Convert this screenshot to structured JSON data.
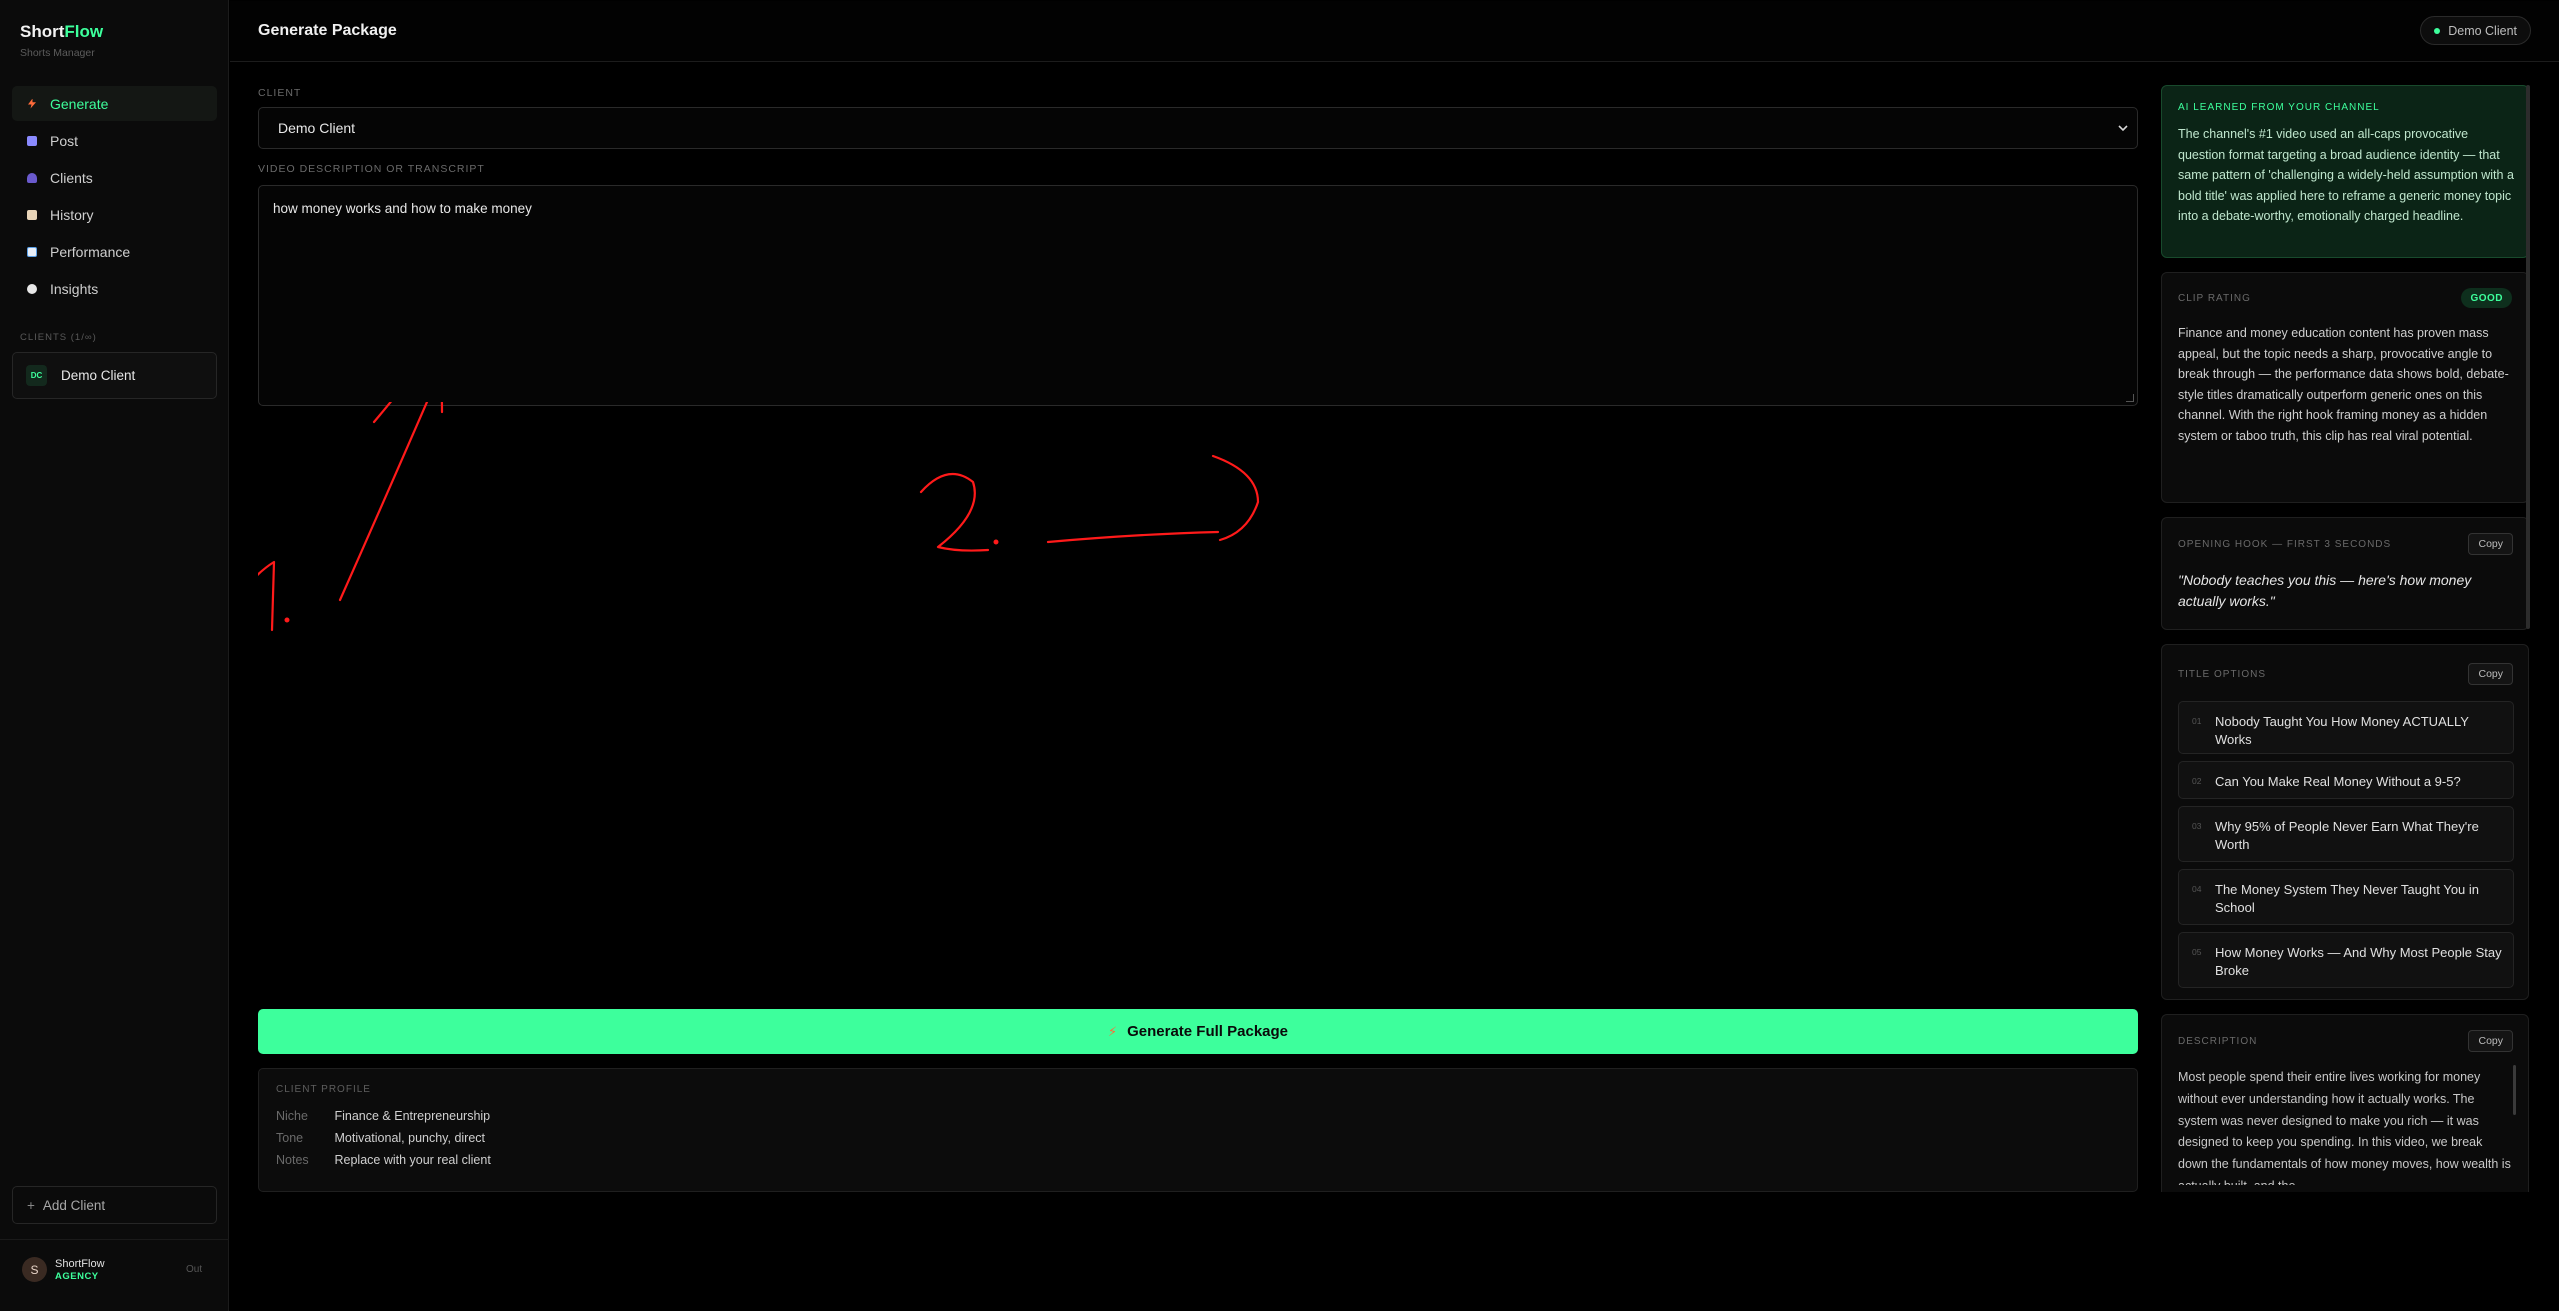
{
  "brand": {
    "name_main": "Short",
    "name_accent": "Flow",
    "subtitle": "Shorts Manager"
  },
  "nav": [
    {
      "label": "Generate",
      "icon": "bolt-icon",
      "color": "#ff6b3a",
      "active": true
    },
    {
      "label": "Post",
      "icon": "calendar-icon",
      "color": "#8a8aff"
    },
    {
      "label": "Clients",
      "icon": "users-icon",
      "color": "#6a5acd"
    },
    {
      "label": "History",
      "icon": "clipboard-icon",
      "color": "#e8d4b8"
    },
    {
      "label": "Performance",
      "icon": "chart-icon",
      "color": "#5aa0e8"
    },
    {
      "label": "Insights",
      "icon": "chat-bubble-icon",
      "color": "#cfcfcf"
    }
  ],
  "clients_section": {
    "title": "CLIENTS (1/∞)",
    "client_initials": "DC",
    "client_name": "Demo Client"
  },
  "add_client": {
    "plus": "+",
    "label": "Add Client"
  },
  "user": {
    "initial": "S",
    "name": "ShortFlow",
    "plan": "AGENCY",
    "logout": "Out"
  },
  "header": {
    "title": "Generate Package",
    "client_pill": "Demo Client"
  },
  "form": {
    "client_label": "CLIENT",
    "client_value": "Demo Client",
    "description_label": "VIDEO DESCRIPTION OR TRANSCRIPT",
    "description_value": "how money works and how to make money",
    "generate_label": "Generate Full Package"
  },
  "profile": {
    "title": "CLIENT PROFILE",
    "rows": [
      {
        "key": "Niche",
        "value": "Finance & Entrepreneurship"
      },
      {
        "key": "Tone",
        "value": "Motivational, punchy, direct"
      },
      {
        "key": "Notes",
        "value": "Replace with your real client"
      }
    ]
  },
  "ai_learned": {
    "title": "AI LEARNED FROM YOUR CHANNEL",
    "text": "The channel's #1 video used an all-caps provocative question format targeting a broad audience identity — that same pattern of 'challenging a widely-held assumption with a bold title' was applied here to reframe a generic money topic into a debate-worthy, emotionally charged headline."
  },
  "clip_rating": {
    "title": "CLIP RATING",
    "badge": "GOOD",
    "text": "Finance and money education content has proven mass appeal, but the topic needs a sharp, provocative angle to break through — the performance data shows bold, debate-style titles dramatically outperform generic ones on this channel. With the right hook framing money as a hidden system or taboo truth, this clip has real viral potential."
  },
  "opening_hook": {
    "title": "OPENING HOOK — FIRST 3 SECONDS",
    "copy": "Copy",
    "text": "\"Nobody teaches you this — here's how money actually works.\""
  },
  "title_options": {
    "title": "TITLE OPTIONS",
    "copy": "Copy",
    "items": [
      {
        "num": "01",
        "text": "Nobody Taught You How Money ACTUALLY Works"
      },
      {
        "num": "02",
        "text": "Can You Make Real Money Without a 9-5?"
      },
      {
        "num": "03",
        "text": "Why 95% of People Never Earn What They're Worth"
      },
      {
        "num": "04",
        "text": "The Money System They Never Taught You in School"
      },
      {
        "num": "05",
        "text": "How Money Works — And Why Most People Stay Broke"
      }
    ]
  },
  "description": {
    "title": "DESCRIPTION",
    "copy": "Copy",
    "text": "Most people spend their entire lives working for money without ever understanding how it actually works. The system was never designed to make you rich — it was designed to keep you spending. In this video, we break down the fundamentals of how money moves, how wealth is actually built, and the"
  },
  "annotations": {
    "label_1": "1.",
    "label_2": "2.",
    "stroke_color": "#ff1a1a"
  },
  "colors": {
    "accent": "#3dff9c",
    "background": "#000000",
    "sidebar": "#0b0b0b"
  }
}
